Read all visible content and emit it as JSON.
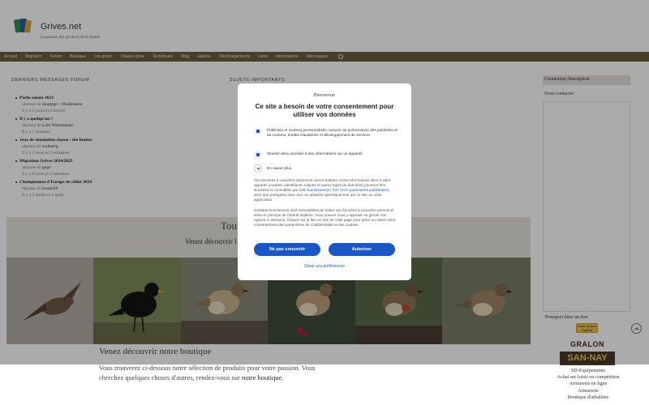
{
  "colors": {
    "nav_bg": "#6b5d3e",
    "accent_blue": "#1a57c6",
    "band_bg": "#e6e3dc"
  },
  "site": {
    "title": "Grives.net",
    "tagline": "La passion des grives et de la chasse"
  },
  "nav": {
    "items": [
      "Accueil",
      "Migration",
      "Forum",
      "Boutique",
      "Les grives",
      "Chasse grive",
      "Techniques",
      "Blog",
      "Galerie",
      "Téléchargements",
      "Liens",
      "Informations",
      "Mon espace"
    ],
    "search_icon": "search-icon"
  },
  "forum": {
    "title": "DERNIERS MESSAGES FORUM",
    "reply_prefix": "réponse de",
    "entries": [
      {
        "topic": "Pêche saison 2023",
        "author": "dougege – Modérateur",
        "time": "Il y a 3 jours et 2 heures"
      },
      {
        "topic": "Il y a quelqu'un ?",
        "author": "Lolo Wehrmaster",
        "time": "Il y a 1 semaine"
      },
      {
        "topic": "Jeux de simulation chasse : the hunter",
        "author": "walberrg",
        "time": "Il y a 1 mois et 3 semaines"
      },
      {
        "topic": "Migration Grives 2024/2025",
        "author": "gege",
        "time": "Il y a 8 mois et 2 semaines"
      },
      {
        "topic": "Championnat d'Europe de chilet 2024",
        "author": "koudo26",
        "time": "Il y a 1 année et 1 mois"
      }
    ]
  },
  "sujets": {
    "title": "SUJETS IMPORTANTS"
  },
  "band": {
    "title": "Tout",
    "subtitle": "Venez découvrir l"
  },
  "photos": [
    "bird-photo-flying",
    "bird-photo-blackbird",
    "bird-photo-song-thrush",
    "bird-photo-mistle-thrush",
    "bird-photo-redwing",
    "bird-photo-fieldfare"
  ],
  "boutique": {
    "title": "Venez découvrir notre boutique",
    "text": "Vous trouverez ci-dessous notre sélection de produits pour votre passion. Vous cherchez quelques choses d'autres, rendez-vous sur",
    "link": "notre boutique",
    "end": "."
  },
  "sidebar": {
    "connexion": "Connexion",
    "separator": "|",
    "inscription": "Inscription",
    "contact": "Nous contacter",
    "donate": "Pourquoi faire un don",
    "paypal_line1": "Faire un don",
    "paypal_line2": "PayPal",
    "sponsor_top": "GRALON",
    "sponsor_bottom": "SAN-NAY",
    "sponsor_lines": [
      "SD-Equipements",
      "Achat arc loisir ou compétition",
      "Armurerie en ligne",
      "Armurerie",
      "Boutique d'arbalètes"
    ]
  },
  "consent": {
    "welcome": "Bienvenue",
    "heading": "Ce site a besoin de votre consentement pour utiliser vos données",
    "purpose1": "Publicités et contenu personnalisés, mesure de performance des publicités et du contenu, études d'audience et développement de services",
    "purpose2": "Stocker et/ou accéder à des informations sur un appareil",
    "more": "En savoir plus",
    "para1_a": "Vos données à caractère personnel seront traitées, et les informations liées à votre appareil (cookies, identifiants uniques et autres types de données) pourront être stockées et consultées par",
    "para1_link": "145 fournisseurs(s) TCF et 67 partenaires publicitaires",
    "para1_b": ", ainsi que partagées avec eux, ou utilisées spécifiquement par ce site ou cette application.",
    "para2": "Certains fournisseurs sont susceptibles de traiter vos données à caractère personnel selon le principe de l'intérêt légitime. Vous pouvez vous y opposer en gérant vos options ci-dessous. Cliquez sur le lien en bas de cette page pour gérer ou retirer votre consentement des paramètres de confidentialité et des cookies.",
    "decline": "Ne pas consentir",
    "accept": "Autoriser",
    "prefs": "Gérer vos préférences"
  }
}
